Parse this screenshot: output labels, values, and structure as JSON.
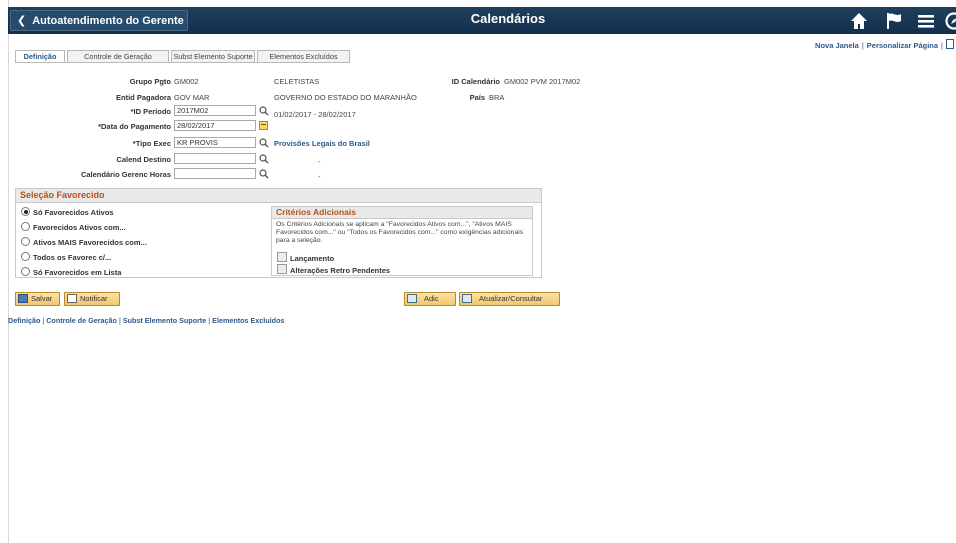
{
  "header": {
    "back_label": "Autoatendimento do Gerente",
    "title": "Calendários",
    "icons": [
      "home-icon",
      "flag-icon",
      "menu-icon",
      "navbar-icon"
    ]
  },
  "top_links": {
    "new_window": "Nova Janela",
    "personalize": "Personalizar Página"
  },
  "tabs": [
    {
      "label": "Definição",
      "active": true
    },
    {
      "label": "Controle de Geração",
      "active": false
    },
    {
      "label": "Subst Elemento Suporte",
      "active": false
    },
    {
      "label": "Elementos Excluídos",
      "active": false
    }
  ],
  "form": {
    "grupo_pgto_label": "Grupo Pgto",
    "grupo_pgto_value": "GM002",
    "grupo_pgto_desc": "CELETISTAS",
    "id_calendario_label": "ID Calendário",
    "id_calendario_value": "GM002 PVM 2017M02",
    "entid_label": "Entid Pagadora",
    "entid_value": "GOV MAR",
    "entid_desc": "GOVERNO DO ESTADO DO MARANHÃO",
    "pais_label": "País",
    "pais_value": "BRA",
    "id_periodo_label": "*ID Período",
    "id_periodo_value": "2017M02",
    "periodo_range": "01/02/2017  -  28/02/2017",
    "data_pagamento_label": "*Data do Pagamento",
    "data_pagamento_value": "28/02/2017",
    "tipo_exec_label": "*Tipo Exec",
    "tipo_exec_value": "KR PROVIS",
    "tipo_exec_desc": "Provisões Legais do Brasil",
    "calend_destino_label": "Calend Destino",
    "calend_destino_value": "",
    "calend_destino_dash": "-",
    "calendario_gerenc_label": "Calendário Gerenc Horas",
    "calendario_gerenc_value": "",
    "calendario_gerenc_dash": "-"
  },
  "selection": {
    "title": "Seleção Favorecido",
    "options": [
      {
        "label": "Só Favorecidos Ativos",
        "selected": true
      },
      {
        "label": "Favorecidos Ativos com...",
        "selected": false
      },
      {
        "label": "Ativos MAIS Favorecidos com...",
        "selected": false
      },
      {
        "label": "Todos os Favorec c/...",
        "selected": false
      },
      {
        "label": "Só Favorecidos em Lista",
        "selected": false
      }
    ],
    "criteria": {
      "title": "Critérios Adicionais",
      "text": "Os Critérios Adicionais se aplicam a \"Favorecidos Ativos com...\", \"Ativos MAIS Favorecidos com...\" ou \"Todos os Favorecidos com...\" como exigências adicionais para a seleção.",
      "checkboxes": [
        {
          "label": "Lançamento",
          "checked": false
        },
        {
          "label": "Alterações Retro Pendentes",
          "checked": false
        }
      ]
    }
  },
  "buttons": {
    "save": "Salvar",
    "notify": "Notificar",
    "add": "Adic",
    "update": "Atualizar/Consultar"
  },
  "bottom_links": [
    "Definição",
    "Controle de Geração",
    "Subst Elemento Suporte",
    "Elementos Excluídos"
  ]
}
